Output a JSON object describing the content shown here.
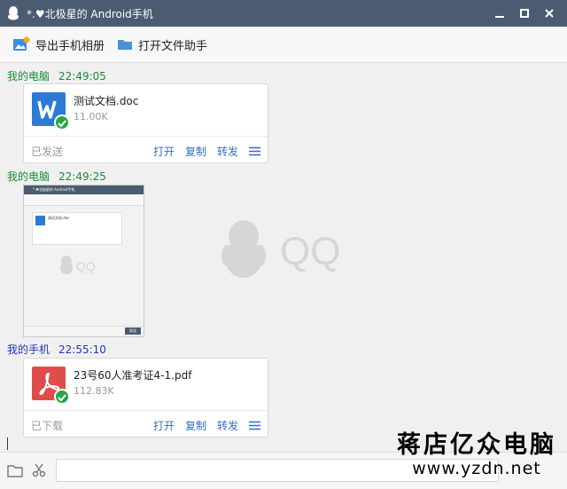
{
  "window": {
    "title": "*.♥北极星的 Android手机",
    "icons": [
      "qq-penguin-icon",
      "minimize-icon",
      "maximize-icon",
      "close-icon"
    ]
  },
  "toolbar": {
    "export_album": "导出手机相册",
    "open_file_helper": "打开文件助手"
  },
  "messages": [
    {
      "sender": "我的电脑",
      "time": "22:49:05",
      "type": "file",
      "file_name": "测试文档.doc",
      "file_size": "11.00K",
      "status": "已发送",
      "actions": [
        "打开",
        "复制",
        "转发"
      ],
      "icon": "word-doc-icon",
      "accent": "#2b7bd6"
    },
    {
      "sender": "我的电脑",
      "time": "22:49:25",
      "type": "image",
      "thumb": {
        "title": "*.♥北极星的 Android手机",
        "file_name": "测试文档.doc",
        "send": "发送"
      }
    },
    {
      "sender": "我的手机",
      "time": "22:55:10",
      "type": "file",
      "file_name": "23号60人准考证4-1.pdf",
      "file_size": "112.83K",
      "status": "已下载",
      "actions": [
        "打开",
        "复制",
        "转发"
      ],
      "icon": "pdf-icon",
      "accent": "#e04c4c"
    }
  ],
  "watermark": "QQ",
  "site": {
    "name": "蒋店亿众电脑",
    "url": "www.yzdn.net"
  },
  "colors": {
    "titlebar": "#4a5b72",
    "link": "#2f6fc9",
    "sender_pc": "#1a8a3a",
    "sender_phone": "#2435b6",
    "check": "#27a745"
  }
}
